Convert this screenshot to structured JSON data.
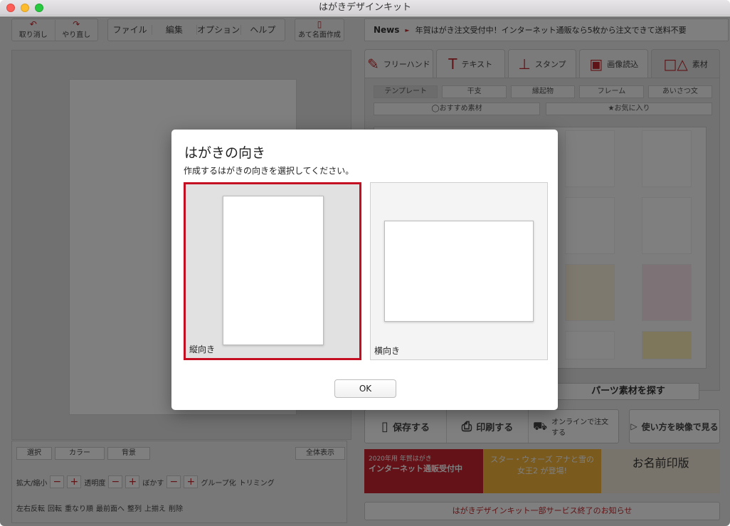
{
  "window": {
    "title": "はがきデザインキット"
  },
  "toolbar": {
    "undo": "取り消し",
    "redo": "やり直し",
    "menus": [
      "ファイル",
      "編集",
      "オプション",
      "ヘルプ"
    ],
    "address": "あて名面作成"
  },
  "news": {
    "label": "News",
    "text": "年賀はがき注文受付中！インターネット通販なら5枚から注文できて送料不要"
  },
  "tabs": [
    "フリーハンド",
    "テキスト",
    "スタンプ",
    "画像読込",
    "素材"
  ],
  "subtabs": [
    "テンプレート",
    "干支",
    "縁起物",
    "フレーム",
    "あいさつ文"
  ],
  "rec": {
    "recommended": "おすすめ素材",
    "favorites": "お気に入り"
  },
  "panel": {
    "explore": "パーツ素材を探す"
  },
  "actions": {
    "save": "保存する",
    "print": "印刷する",
    "order": "オンラインで注文する",
    "howto": "使い方を映像で見る"
  },
  "banner": {
    "title": "インターネット通販受付中",
    "sub": "2020年用 年賀はがき",
    "campaign": "スター・ウォーズ アナと雪の女王2 が登場!",
    "brand": "お名前印版"
  },
  "notice": "はがきデザインキット一部サービス終了のお知らせ",
  "bottom": {
    "select": "選択",
    "color": "カラー",
    "bg": "背景",
    "fullview": "全体表示",
    "scale": "拡大/縮小",
    "opacity": "透明度",
    "blur": "ぼかす",
    "group": "グループ化",
    "trim": "トリミング",
    "flip": "左右反転",
    "rotate": "回転",
    "order": "重なり順",
    "front": "最前面へ",
    "align": "整列",
    "alignTop": "上揃え",
    "delete": "削除"
  },
  "dialog": {
    "title": "はがきの向き",
    "subtitle": "作成するはがきの向きを選択してください。",
    "portrait": "縦向き",
    "landscape": "横向き",
    "ok": "OK"
  },
  "colors": {
    "accent": "#c40f23",
    "overlay": "rgba(0,0,0,0.5)"
  }
}
